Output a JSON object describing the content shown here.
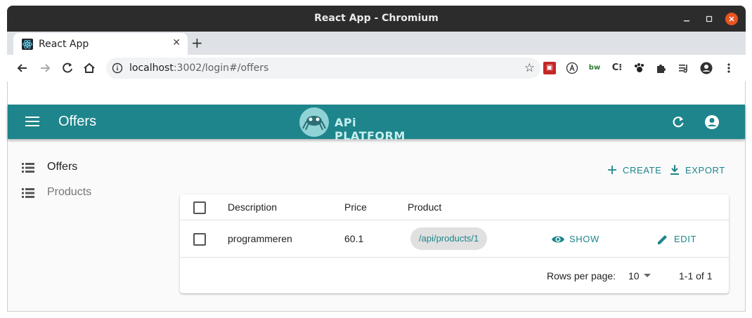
{
  "window": {
    "title": "React App - Chromium"
  },
  "tab": {
    "title": "React App",
    "close": "✕",
    "new_tab": "+"
  },
  "address": {
    "host": "localhost",
    "path": ":3002/login#/offers"
  },
  "app": {
    "title": "Offers",
    "logo_text": "APi PLATFORM",
    "accent": "#1d858b"
  },
  "sidebar": {
    "items": [
      {
        "label": "Offers",
        "active": true
      },
      {
        "label": "Products",
        "active": false
      }
    ]
  },
  "actions": {
    "create": "CREATE",
    "export": "EXPORT"
  },
  "table": {
    "headers": {
      "description": "Description",
      "price": "Price",
      "product": "Product"
    },
    "rows": [
      {
        "description": "programmeren",
        "price": "60.1",
        "product": "/api/products/1",
        "show": "SHOW",
        "edit": "EDIT"
      }
    ]
  },
  "pagination": {
    "rows_per_page_label": "Rows per page:",
    "rows_per_page": "10",
    "range": "1-1 of 1"
  }
}
